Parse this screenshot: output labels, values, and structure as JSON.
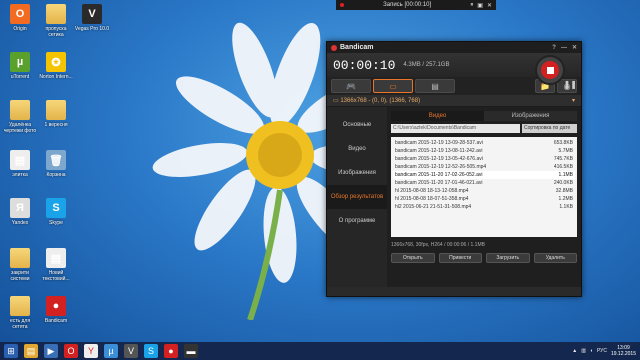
{
  "desktop_icons": [
    {
      "label": "Origin",
      "glyph": "O",
      "color": "#f26b21"
    },
    {
      "label": "пропуска сетика",
      "glyph": "",
      "color": "folder"
    },
    {
      "label": "Vegas Pro 10.0",
      "glyph": "V",
      "color": "#2a2a2a"
    },
    {
      "label": "uTorrent",
      "glyph": "µ",
      "color": "#5aa02c"
    },
    {
      "label": "Norton Intern...",
      "glyph": "✪",
      "color": "#f5c400"
    },
    {
      "label": "Удалёнка чертежи фото",
      "glyph": "",
      "color": "folder"
    },
    {
      "label": "1 вересня",
      "glyph": "",
      "color": "folder"
    },
    {
      "label": "элитка",
      "glyph": "▤",
      "color": "#eeeeee"
    },
    {
      "label": "Корзина",
      "glyph": "🗑",
      "color": "#7da7cc"
    },
    {
      "label": "Yandex",
      "glyph": "Я",
      "color": "#dddddd"
    },
    {
      "label": "Skype",
      "glyph": "S",
      "color": "#1aa3e8"
    },
    {
      "label": "закрити системи",
      "glyph": "",
      "color": "folder"
    },
    {
      "label": "Новий текстовий...",
      "glyph": "▤",
      "color": "#eeeeee"
    },
    {
      "label": "есть для сетята",
      "glyph": "",
      "color": "folder"
    },
    {
      "label": "Bandicam",
      "glyph": "●",
      "color": "#d32020"
    }
  ],
  "recording_bar": {
    "title": "Запись [00:00:10]"
  },
  "bandicam": {
    "title": "Bandicam",
    "time": "00:00:10",
    "size": "4.3MB / 257.1GB",
    "resolution": "1366x768 - (0, 0), (1366, 768)",
    "sidebar": [
      "Основные",
      "Видео",
      "Изображения",
      "Обзор результатов",
      "О программе"
    ],
    "active_sidebar": 3,
    "tabs": [
      "Видео",
      "Изображения"
    ],
    "path": "C:\\Users\\aztek\\Documents\\Bandicam",
    "sort": "Сортировка по дате",
    "files": [
      {
        "name": "bandicam 2015-12-19 13-09-28-537.avi",
        "size": "653.8KB"
      },
      {
        "name": "bandicam 2015-12-19 13-08-11-242.avi",
        "size": "5.7MB"
      },
      {
        "name": "bandicam 2015-12-19 13-05-42-676.avi",
        "size": "745.7KB"
      },
      {
        "name": "bandicam 2015-12-19 12-52-26-505.mp4",
        "size": "416.5KB"
      },
      {
        "name": "bandicam 2015-11-20 17-02-26-052.avi",
        "size": "1.1MB"
      },
      {
        "name": "bandicam 2015-11-20 17-01-46-021.avi",
        "size": "240.0KB"
      },
      {
        "name": "hl 2015-08-08 18-13-12-058.mp4",
        "size": "32.8MB"
      },
      {
        "name": "hl 2015-08-08 18-07-51-358.mp4",
        "size": "1.2MB"
      },
      {
        "name": "hl2 2015-06-21 21-51-31-508.mp4",
        "size": "1.1KB"
      }
    ],
    "selected_file": 4,
    "status": "1366x768, 30fps, H264 / 00:00:06 / 1.1MB",
    "buttons": [
      "Открыть",
      "Привести",
      "Загрузить",
      "Удалить"
    ]
  },
  "taskbar": {
    "tray_lang": "РУС",
    "time": "13:09",
    "date": "19.12.2015"
  }
}
